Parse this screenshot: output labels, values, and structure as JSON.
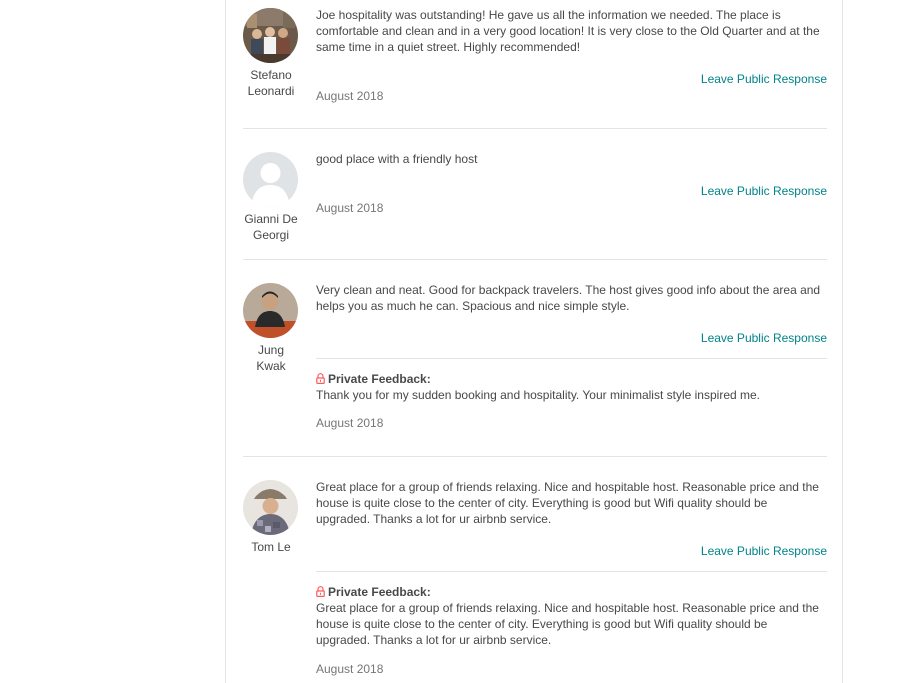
{
  "reviews": [
    {
      "name_line1": "Stefano",
      "name_line2": "Leonardi",
      "text": "Joe hospitality was outstanding! He gave us all the information we needed. The place is comfortable and clean and in a very good location! It is very close to the Old Quarter and at the same time in a quiet street. Highly recommended!",
      "respond_label": "Leave Public Response",
      "date": "August 2018"
    },
    {
      "name_line1": "Gianni De",
      "name_line2": "Georgi",
      "text": "good place with a friendly host",
      "respond_label": "Leave Public Response",
      "date": "August 2018"
    },
    {
      "name_line1": "Jung",
      "name_line2": "Kwak",
      "text": "Very clean and neat. Good for backpack travelers. The host gives good info about the area and helps you as much he can. Spacious and nice simple style.",
      "respond_label": "Leave Public Response",
      "private_title": "Private Feedback:",
      "private_text": "Thank you for my sudden booking and hospitality. Your minimalist style inspired me.",
      "date": "August 2018"
    },
    {
      "name_line1": "Tom Le",
      "name_line2": "",
      "text": "Great place for a group of friends relaxing. Nice and hospitable host. Reasonable price and the house is quite close to the center of city. Everything is good but Wifi quality should be upgraded. Thanks a lot for ur airbnb service.",
      "respond_label": "Leave Public Response",
      "private_title": "Private Feedback:",
      "private_text": "Great place for a group of friends relaxing. Nice and hospitable host. Reasonable price and the house is quite close to the center of city. Everything is good but Wifi quality should be upgraded. Thanks a lot for ur airbnb service.",
      "date": "August 2018"
    }
  ],
  "colors": {
    "link": "#008489",
    "text": "#484848",
    "muted": "#767676",
    "border": "#e4e4e4",
    "lock": "#ff5a5f"
  }
}
